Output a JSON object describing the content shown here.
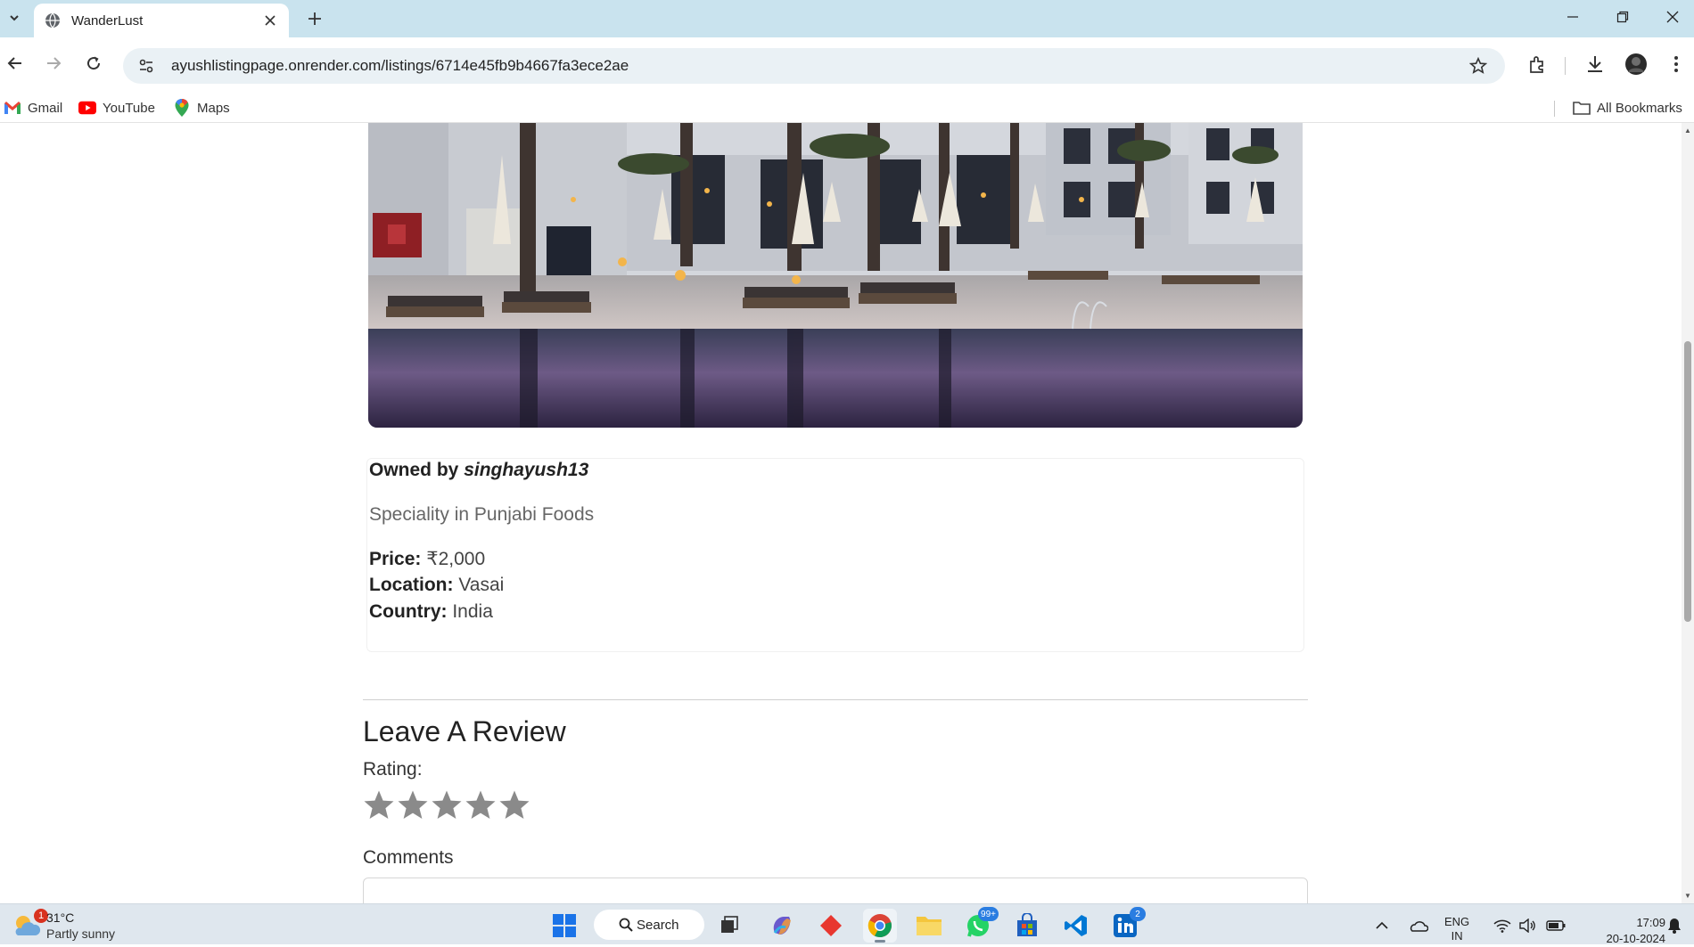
{
  "browser": {
    "tab_title": "WanderLust",
    "url": "ayushlistingpage.onrender.com/listings/6714e45fb9b4667fa3ece2ae",
    "bookmarks": [
      {
        "label": "Gmail"
      },
      {
        "label": "YouTube"
      },
      {
        "label": "Maps"
      }
    ],
    "all_bookmarks_label": "All Bookmarks"
  },
  "listing": {
    "owned_by_label": "Owned by",
    "owner": "singhayush13",
    "description": "Speciality in Punjabi Foods",
    "price_label": "Price:",
    "price": "₹2,000",
    "location_label": "Location:",
    "location": "Vasai",
    "country_label": "Country:",
    "country": "India"
  },
  "review_form": {
    "heading": "Leave A Review",
    "rating_label": "Rating:",
    "stars_max": 5,
    "comments_label": "Comments"
  },
  "taskbar": {
    "weather_badge": "1",
    "temperature": "31°C",
    "condition": "Partly sunny",
    "search_label": "Search",
    "whatsapp_badge": "99+",
    "linkedin_badge": "2",
    "lang_line1": "ENG",
    "lang_line2": "IN",
    "time": "17:09",
    "date": "20-10-2024"
  },
  "colors": {
    "tabstrip_bg": "#c9e3ee",
    "omnibox_bg": "#eaf1f5",
    "star_gray": "#8a8a8a",
    "taskbar_bg": "#dfe7ee"
  }
}
